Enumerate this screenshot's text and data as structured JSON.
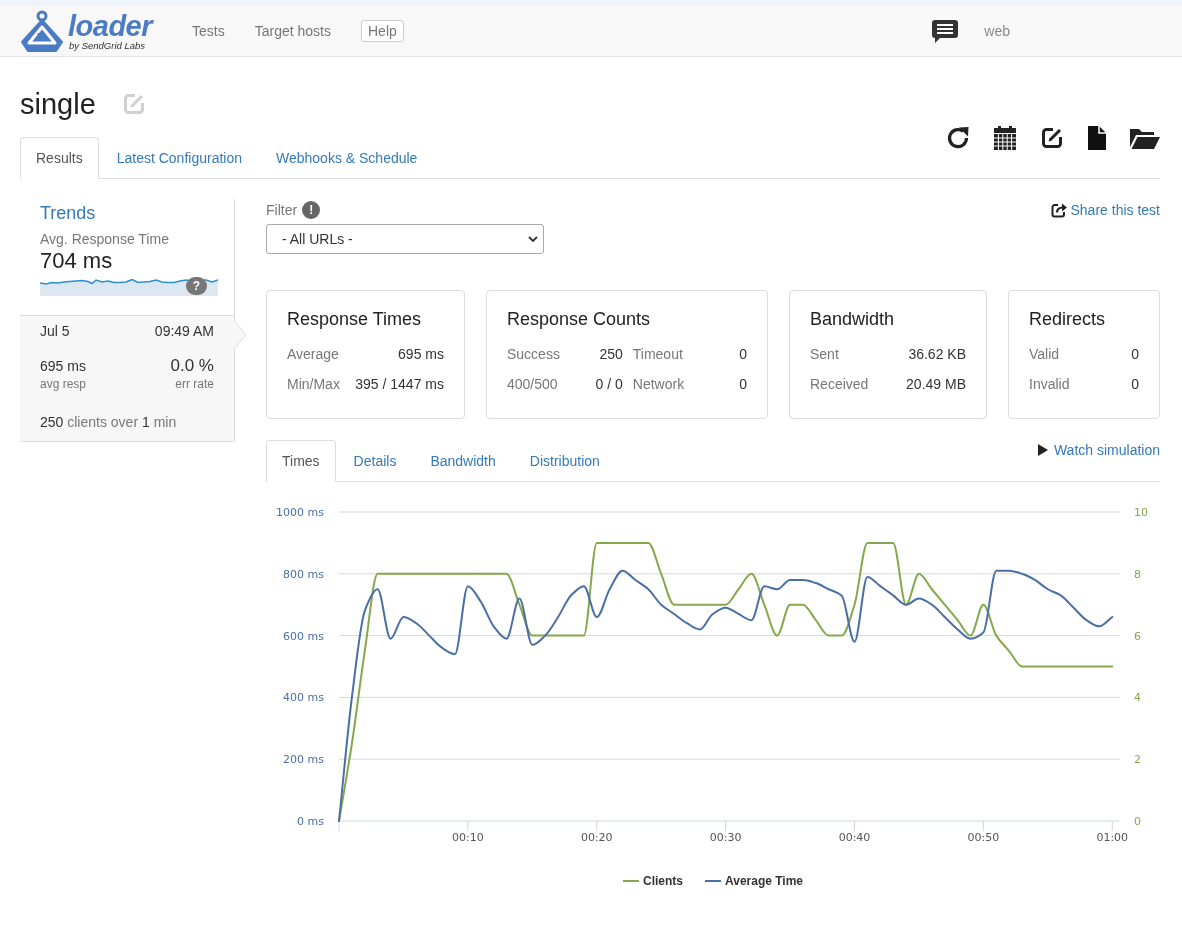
{
  "navbar": {
    "brand": "loader",
    "tagline": "by SendGrid Labs",
    "links": [
      {
        "label": "Tests",
        "kind": "link"
      },
      {
        "label": "Target hosts",
        "kind": "link"
      },
      {
        "label": "Help",
        "kind": "button"
      }
    ],
    "user": "web"
  },
  "test": {
    "name": "single"
  },
  "tabs": [
    {
      "label": "Results",
      "selected": true
    },
    {
      "label": "Latest Configuration",
      "selected": false
    },
    {
      "label": "Webhooks & Schedule",
      "selected": false
    }
  ],
  "trends": {
    "title": "Trends",
    "metric": "Avg. Response Time",
    "value": "704 ms",
    "help": "?"
  },
  "runs": [
    {
      "selected": true,
      "date": "Jul 5",
      "time": "09:49 AM",
      "avg": "695 ms",
      "avg_label": "avg resp",
      "error_rate": "0.0 %",
      "error_label": "err rate",
      "clients": "250",
      "clients_text": "clients over",
      "duration": "1",
      "duration_text": "min"
    }
  ],
  "filter": {
    "label": "Filter",
    "hint": "!",
    "value": "- All URLs -"
  },
  "share": "Share this test",
  "stats": [
    {
      "title": "Response Times",
      "rows": [
        [
          {
            "label": "Average",
            "value": "695 ms"
          }
        ],
        [
          {
            "label": "Min/Max",
            "value": "395 / 1447 ms"
          }
        ]
      ]
    },
    {
      "title": "Response Counts",
      "rows": [
        [
          {
            "label": "Success",
            "value": "250"
          },
          {
            "label": "Timeout",
            "value": "0"
          }
        ],
        [
          {
            "label": "400/500",
            "value": "0 / 0"
          },
          {
            "label": "Network",
            "value": "0"
          }
        ]
      ]
    },
    {
      "title": "Bandwidth",
      "rows": [
        [
          {
            "label": "Sent",
            "value": "36.62 KB"
          }
        ],
        [
          {
            "label": "Received",
            "value": "20.49 MB"
          }
        ]
      ]
    },
    {
      "title": "Redirects",
      "rows": [
        [
          {
            "label": "Valid",
            "value": "0"
          }
        ],
        [
          {
            "label": "Invalid",
            "value": "0"
          }
        ]
      ]
    }
  ],
  "chart_tabs": [
    {
      "label": "Times",
      "selected": true
    },
    {
      "label": "Details",
      "selected": false
    },
    {
      "label": "Bandwidth",
      "selected": false
    },
    {
      "label": "Distribution",
      "selected": false
    }
  ],
  "watch": "Watch simulation",
  "chart": {
    "chart_data": {
      "type": "line",
      "grid": true,
      "legend": "bottom",
      "x": [
        0,
        1,
        2,
        3,
        4,
        5,
        6,
        7,
        8,
        9,
        10,
        11,
        12,
        13,
        14,
        15,
        16,
        17,
        18,
        19,
        20,
        21,
        22,
        23,
        24,
        25,
        26,
        27,
        28,
        29,
        30,
        31,
        32,
        33,
        34,
        35,
        36,
        37,
        38,
        39,
        40,
        41,
        42,
        43,
        44,
        45,
        46,
        47,
        48,
        49,
        50,
        51,
        52,
        53,
        54,
        55,
        56,
        57,
        58,
        59,
        60
      ],
      "xlim": [
        0,
        60.6
      ],
      "xticks": [
        {
          "value": 10,
          "label": "00:10"
        },
        {
          "value": 20,
          "label": "00:20"
        },
        {
          "value": 30,
          "label": "00:30"
        },
        {
          "value": 40,
          "label": "00:40"
        },
        {
          "value": 50,
          "label": "00:50"
        },
        {
          "value": 60,
          "label": "01:00"
        }
      ],
      "ylim": [
        0,
        1000
      ],
      "yticks": [
        {
          "value": 0,
          "label": "0 ms"
        },
        {
          "value": 200,
          "label": "200 ms"
        },
        {
          "value": 400,
          "label": "400 ms"
        },
        {
          "value": 600,
          "label": "600 ms"
        },
        {
          "value": 800,
          "label": "800 ms"
        },
        {
          "value": 1000,
          "label": "1000 ms"
        }
      ],
      "y2lim": [
        0,
        10
      ],
      "y2ticks": [
        0,
        2,
        4,
        6,
        8,
        10
      ],
      "series": [
        {
          "name": "Clients",
          "color": "#86a84c",
          "axis": "y2",
          "values": [
            0,
            2.5,
            5.5,
            8,
            8,
            8,
            8,
            8,
            8,
            8,
            8,
            8,
            8,
            8,
            7,
            6,
            6,
            6,
            6,
            6,
            9,
            9,
            9,
            9,
            9,
            8,
            7,
            7,
            7,
            7,
            7,
            7.5,
            8,
            7,
            6,
            7,
            7,
            6.5,
            6,
            6,
            7,
            9,
            9,
            9,
            7,
            8,
            7.5,
            7,
            6.5,
            6,
            7,
            6,
            5.5,
            5,
            5,
            5,
            5,
            5,
            5,
            5,
            5
          ]
        },
        {
          "name": "Average Time",
          "color": "#4a6fa5",
          "values": [
            0,
            400,
            680,
            750,
            590,
            660,
            640,
            600,
            560,
            540,
            760,
            710,
            630,
            590,
            720,
            570,
            600,
            660,
            730,
            760,
            660,
            750,
            810,
            780,
            750,
            700,
            670,
            640,
            620,
            670,
            690,
            670,
            650,
            760,
            750,
            780,
            780,
            770,
            750,
            730,
            580,
            790,
            760,
            730,
            700,
            720,
            700,
            660,
            620,
            590,
            610,
            810,
            810,
            800,
            780,
            750,
            730,
            690,
            650,
            630,
            660
          ]
        }
      ]
    }
  }
}
